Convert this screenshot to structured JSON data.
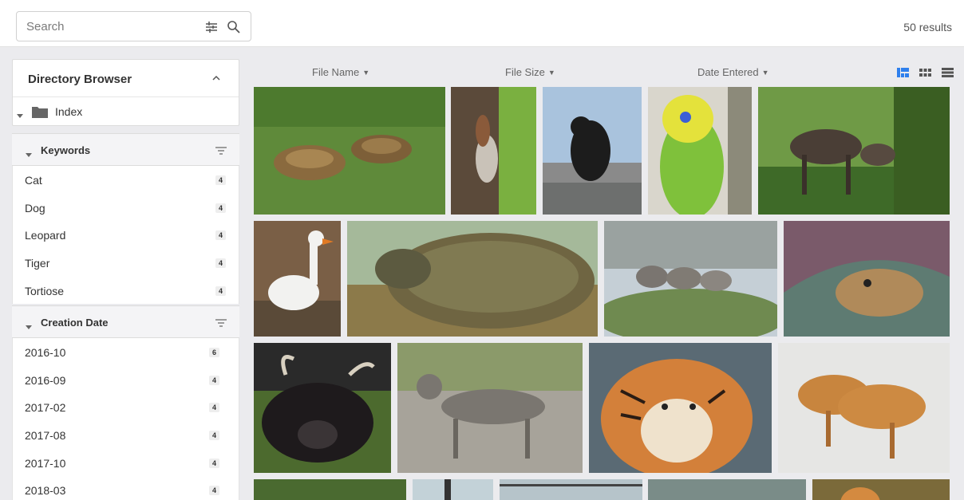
{
  "search": {
    "placeholder": "Search"
  },
  "results_label": "50 results",
  "directory_browser": {
    "title": "Directory Browser",
    "items": [
      {
        "label": "Index"
      }
    ]
  },
  "keywords": {
    "title": "Keywords",
    "items": [
      {
        "label": "Cat",
        "count": "4"
      },
      {
        "label": "Dog",
        "count": "4"
      },
      {
        "label": "Leopard",
        "count": "4"
      },
      {
        "label": "Tiger",
        "count": "4"
      },
      {
        "label": "Tortiose",
        "count": "4"
      }
    ]
  },
  "creation_date": {
    "title": "Creation Date",
    "items": [
      {
        "label": "2016-10",
        "count": "6"
      },
      {
        "label": "2016-09",
        "count": "4"
      },
      {
        "label": "2017-02",
        "count": "4"
      },
      {
        "label": "2017-08",
        "count": "4"
      },
      {
        "label": "2017-10",
        "count": "4"
      },
      {
        "label": "2018-03",
        "count": "4"
      }
    ]
  },
  "columns": {
    "file_name": "File Name",
    "file_size": "File Size",
    "date_entered": "Date Entered"
  },
  "view_modes": [
    "masonry-view-icon",
    "grid-view-icon",
    "list-view-icon"
  ],
  "colors": {
    "accent": "#2f80ed",
    "icon_gray": "#555555"
  },
  "thumbnails": [
    "tortoises-on-grass",
    "squirrel-on-tree",
    "black-cat-on-fence",
    "budgie",
    "moose",
    "white-goose",
    "tortoise-closeup",
    "wolves-on-rock",
    "dog-under-blanket",
    "yak",
    "tabby-cat",
    "tiger-closeup",
    "two-tigers-in-snow",
    "partial-1",
    "partial-2",
    "partial-3",
    "partial-4",
    "partial-5"
  ]
}
